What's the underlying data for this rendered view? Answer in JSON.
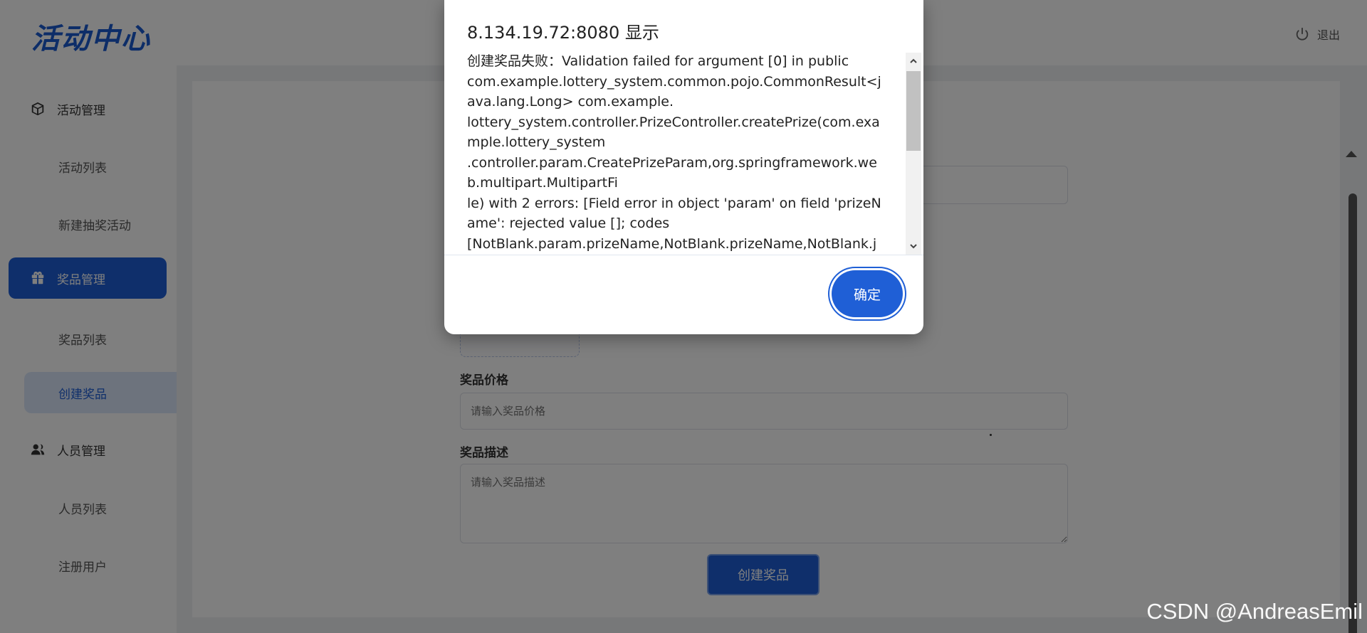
{
  "app": {
    "logo": "活动中心",
    "logout_label": "退出"
  },
  "sidebar": {
    "groups": [
      {
        "label": "活动管理",
        "icon": "cube-icon",
        "items": [
          "活动列表",
          "新建抽奖活动"
        ]
      },
      {
        "label": "奖品管理",
        "icon": "gift-icon",
        "items": [
          "奖品列表",
          "创建奖品"
        ]
      },
      {
        "label": "人员管理",
        "icon": "users-icon",
        "items": [
          "人员列表",
          "注册用户"
        ]
      }
    ],
    "active_group": "奖品管理",
    "active_item": "创建奖品"
  },
  "form": {
    "price_label": "奖品价格",
    "price_placeholder": "请输入奖品价格",
    "desc_label": "奖品描述",
    "desc_placeholder": "请输入奖品描述",
    "submit_label": "创建奖品"
  },
  "dialog": {
    "title": "8.134.19.72:8080 显示",
    "message": "创建奖品失败：Validation failed for argument [0] in public\ncom.example.lottery_system.common.pojo.CommonResult<java.lang.Long> com.example.\nlottery_system.controller.PrizeController.createPrize(com.example.lottery_system\n.controller.param.CreatePrizeParam,org.springframework.web.multipart.MultipartFi\nle) with 2 errors: [Field error in object 'param' on field 'prizeName': rejected value []; codes\n[NotBlank.param.prizeName,NotBlank.prizeName,NotBlank.j",
    "ok_label": "确定"
  },
  "watermark": "CSDN @AndreasEmil",
  "colors": {
    "accent": "#1f5fd6",
    "active_sub_bg": "#dbe7fb"
  }
}
